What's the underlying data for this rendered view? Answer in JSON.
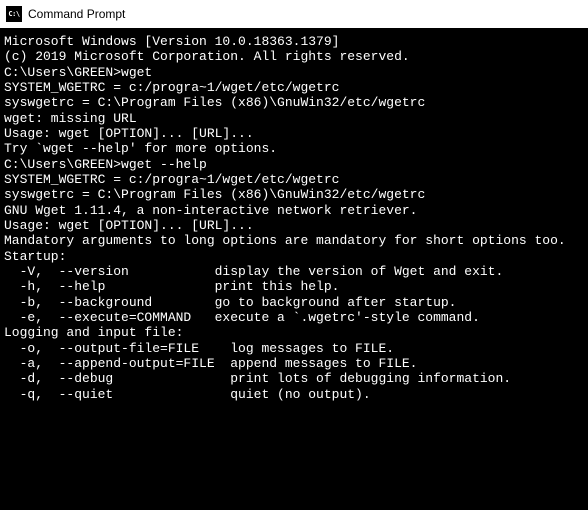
{
  "window": {
    "title": "Command Prompt"
  },
  "terminal": {
    "lines": [
      "Microsoft Windows [Version 10.0.18363.1379]",
      "(c) 2019 Microsoft Corporation. All rights reserved.",
      "",
      "C:\\Users\\GREEN>wget",
      "SYSTEM_WGETRC = c:/progra~1/wget/etc/wgetrc",
      "syswgetrc = C:\\Program Files (x86)\\GnuWin32/etc/wgetrc",
      "wget: missing URL",
      "Usage: wget [OPTION]... [URL]...",
      "",
      "Try `wget --help' for more options.",
      "",
      "C:\\Users\\GREEN>wget --help",
      "SYSTEM_WGETRC = c:/progra~1/wget/etc/wgetrc",
      "syswgetrc = C:\\Program Files (x86)\\GnuWin32/etc/wgetrc",
      "GNU Wget 1.11.4, a non-interactive network retriever.",
      "Usage: wget [OPTION]... [URL]...",
      "",
      "Mandatory arguments to long options are mandatory for short options too.",
      "",
      "Startup:",
      "  -V,  --version           display the version of Wget and exit.",
      "  -h,  --help              print this help.",
      "  -b,  --background        go to background after startup.",
      "  -e,  --execute=COMMAND   execute a `.wgetrc'-style command.",
      "",
      "Logging and input file:",
      "  -o,  --output-file=FILE    log messages to FILE.",
      "  -a,  --append-output=FILE  append messages to FILE.",
      "  -d,  --debug               print lots of debugging information.",
      "  -q,  --quiet               quiet (no output)."
    ]
  }
}
